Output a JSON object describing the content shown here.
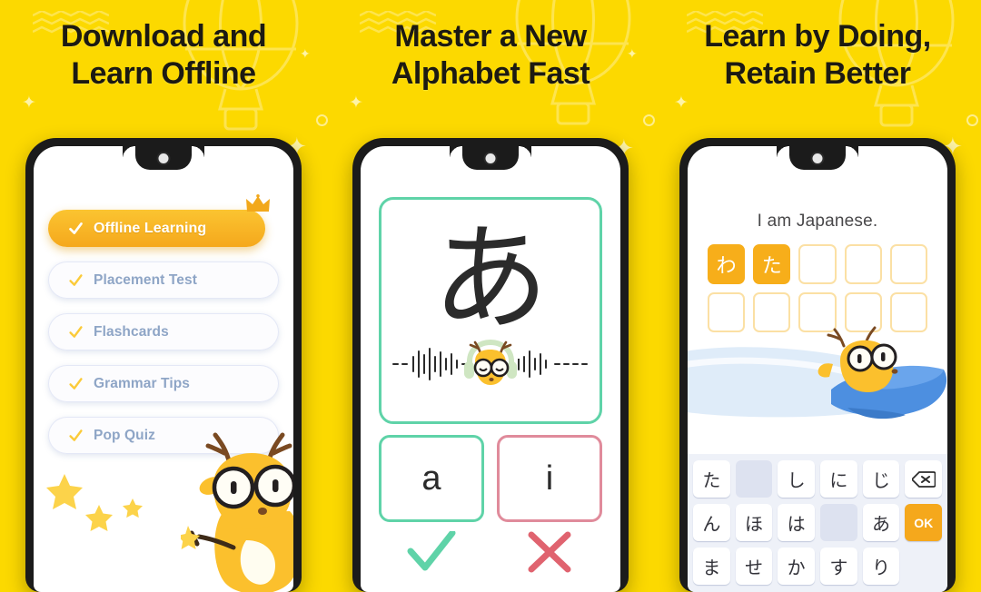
{
  "theme": {
    "background": "#FCD900",
    "accent_orange": "#F7AE1A",
    "accent_green": "#5FD3A8",
    "accent_red": "#E08B9B",
    "headline_color": "#1C1A12",
    "inactive_text": "#8EA5C6"
  },
  "panels": [
    {
      "headline": "Download and\nLearn Offline",
      "feature_list": [
        {
          "label": "Offline Learning",
          "active": true,
          "check_icon": "check-icon",
          "badge_icon": "crown-icon"
        },
        {
          "label": "Placement Test",
          "active": false,
          "check_icon": "check-icon"
        },
        {
          "label": "Flashcards",
          "active": false,
          "check_icon": "check-icon"
        },
        {
          "label": "Grammar Tips",
          "active": false,
          "check_icon": "check-icon"
        },
        {
          "label": "Pop Quiz",
          "active": false,
          "check_icon": "check-icon"
        }
      ],
      "mascot_icon": "deer-mascot-with-wand-icon",
      "decoration_icon": "sparkle-stars-icon"
    },
    {
      "headline": "Master a New\nAlphabet Fast",
      "flashcard": {
        "character": "あ",
        "audio_icon": "audio-waveform-icon",
        "mascot_icon": "deer-mascot-headphones-icon"
      },
      "answers": [
        {
          "label": "a",
          "state": "correct",
          "mark_icon": "check-mark-icon"
        },
        {
          "label": "i",
          "state": "wrong",
          "mark_icon": "cross-mark-icon"
        }
      ]
    },
    {
      "headline": "Learn by Doing,\nRetain Better",
      "prompt": "I am Japanese.",
      "tile_rows": [
        [
          {
            "char": "わ",
            "filled": true
          },
          {
            "char": "た",
            "filled": true
          },
          {
            "char": "",
            "filled": false
          },
          {
            "char": "",
            "filled": false
          },
          {
            "char": "",
            "filled": false
          }
        ],
        [
          {
            "char": "",
            "filled": false
          },
          {
            "char": "",
            "filled": false
          },
          {
            "char": "",
            "filled": false
          },
          {
            "char": "",
            "filled": false
          },
          {
            "char": "",
            "filled": false
          }
        ]
      ],
      "mascot_icon": "deer-mascot-airplane-icon",
      "keyboard": {
        "rows": [
          [
            {
              "label": "た",
              "type": "char"
            },
            {
              "label": "",
              "type": "blank"
            },
            {
              "label": "し",
              "type": "char"
            },
            {
              "label": "に",
              "type": "char"
            },
            {
              "label": "じ",
              "type": "char"
            },
            {
              "label": "⌫",
              "type": "backspace",
              "icon": "backspace-icon"
            }
          ],
          [
            {
              "label": "ん",
              "type": "char"
            },
            {
              "label": "ほ",
              "type": "char"
            },
            {
              "label": "は",
              "type": "char"
            },
            {
              "label": "",
              "type": "blank"
            },
            {
              "label": "あ",
              "type": "char"
            },
            {
              "label": "OK",
              "type": "ok"
            }
          ],
          [
            {
              "label": "ま",
              "type": "char"
            },
            {
              "label": "せ",
              "type": "char"
            },
            {
              "label": "か",
              "type": "char"
            },
            {
              "label": "す",
              "type": "char"
            },
            {
              "label": "り",
              "type": "char"
            },
            {
              "label": "",
              "type": "ghost"
            }
          ]
        ]
      }
    }
  ]
}
